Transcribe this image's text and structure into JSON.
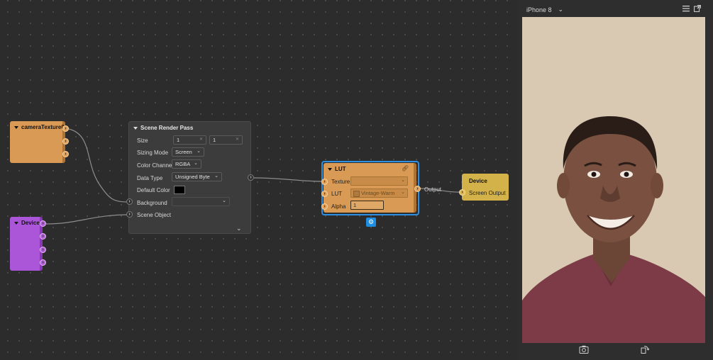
{
  "nodes": {
    "camera": {
      "title": "cameraTexture0"
    },
    "device_left": {
      "title": "Device"
    },
    "scene_render_pass": {
      "title": "Scene Render Pass",
      "size_label": "Size",
      "size_w": "1",
      "size_h": "1",
      "sizing_mode_label": "Sizing Mode",
      "sizing_mode_value": "Screen",
      "color_channel_label": "Color Channel",
      "color_channel_value": "RGBA",
      "data_type_label": "Data Type",
      "data_type_value": "Unsigned Byte",
      "default_color_label": "Default Color",
      "default_color_value": "#000000",
      "background_label": "Background",
      "scene_object_label": "Scene Object"
    },
    "lut": {
      "title": "LUT",
      "texture_label": "Texture",
      "lut_label": "LUT",
      "lut_value": "Vintage-Warm",
      "alpha_label": "Alpha",
      "alpha_value": "1",
      "output_label": "Output"
    },
    "device_right": {
      "title": "Device",
      "screen_output_label": "Screen Output"
    }
  },
  "preview": {
    "device_name": "iPhone 8",
    "background_color": "#d9c9b3"
  },
  "colors": {
    "canvas_bg": "#2c2c2c",
    "orange_node": "#d89a55",
    "purple_node": "#ab55d9",
    "yellow_node": "#d4b24a",
    "selection": "#2f8fe0"
  },
  "icons": {
    "node_collapse": "triangle-down-icon",
    "port": "arrow-right-icon",
    "link": "link-icon",
    "settings": "gear-icon",
    "menu": "hamburger-menu-icon",
    "popout": "popout-icon",
    "capture": "camera-capture-icon",
    "rotate": "rotate-icon"
  }
}
